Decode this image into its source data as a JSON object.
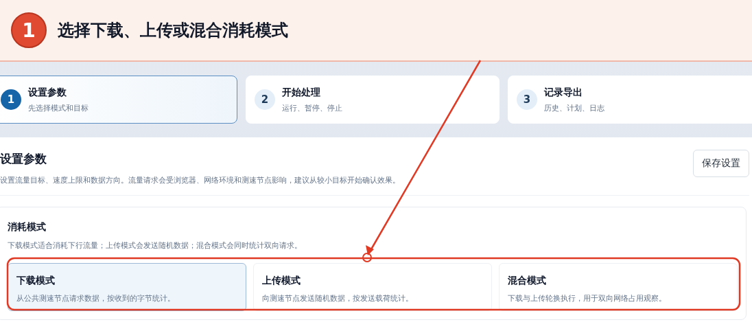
{
  "banner": {
    "step": "1",
    "title": "选择下载、上传或混合消耗模式"
  },
  "steps": [
    {
      "number": "1",
      "title": "设置参数",
      "subtitle": "先选择模式和目标",
      "selected": true
    },
    {
      "number": "2",
      "title": "开始处理",
      "subtitle": "运行、暂停、停止",
      "selected": false
    },
    {
      "number": "3",
      "title": "记录导出",
      "subtitle": "历史、计划、日志",
      "selected": false
    }
  ],
  "section": {
    "title": "设置参数",
    "description": "设置流量目标、速度上限和数据方向。流量请求会受浏览器、网络环境和测速节点影响，建议从较小目标开始确认效果。",
    "button": "保存设置"
  },
  "mode_group": {
    "title": "消耗模式",
    "description": "下载模式适合消耗下行流量；上传模式会发送随机数据；混合模式会同时统计双向请求。",
    "options": [
      {
        "title": "下载模式",
        "description": "从公共测速节点请求数据，按收到的字节统计。",
        "selected": true
      },
      {
        "title": "上传模式",
        "description": "向测速节点发送随机数据，按发送载荷统计。",
        "selected": false
      },
      {
        "title": "混合模式",
        "description": "下载与上传轮换执行，用于双向网络占用观察。",
        "selected": false
      }
    ]
  }
}
